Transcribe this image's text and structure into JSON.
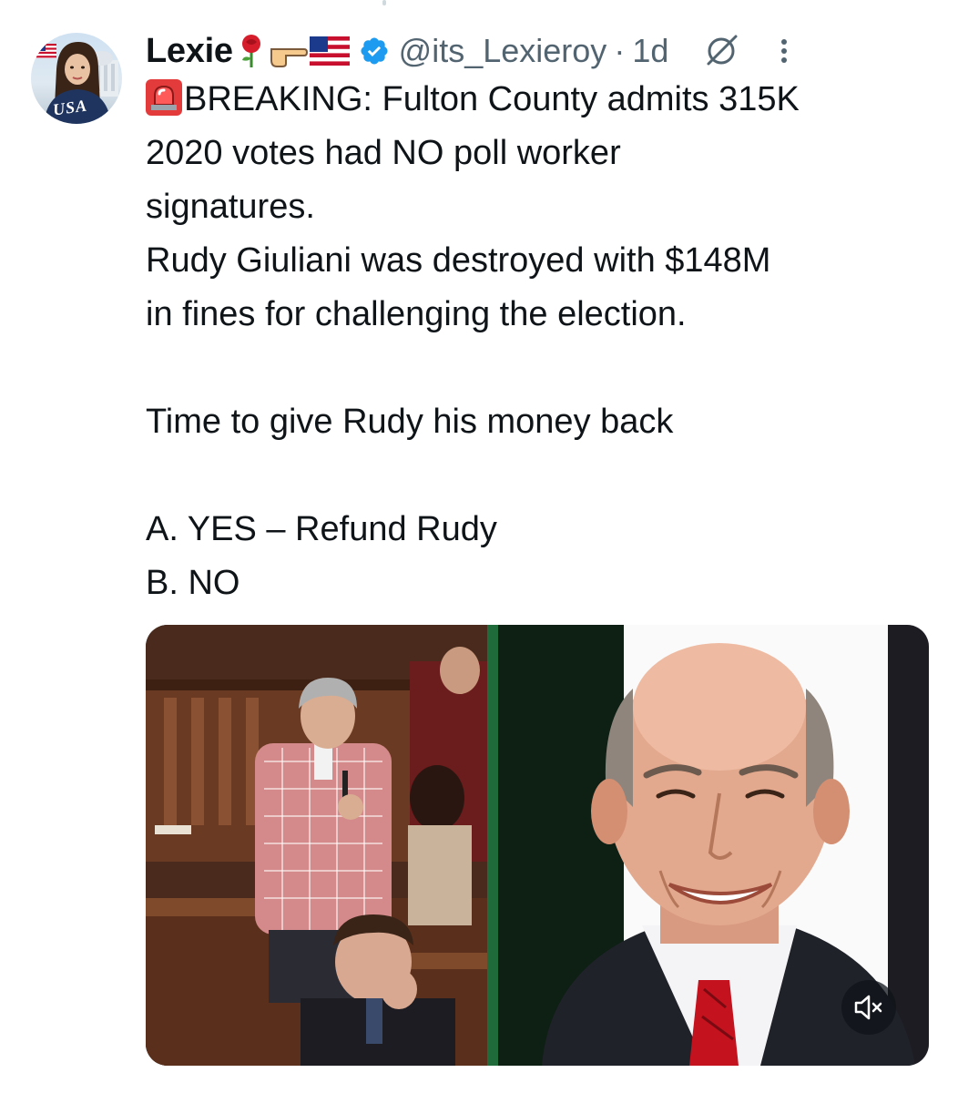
{
  "author": {
    "display_name": "Lexie",
    "handle": "@its_Lexieroy",
    "separator": "·",
    "time": "1d",
    "avatar_text": "USA"
  },
  "header_icons": {
    "name_emojis": [
      "rose-emoji",
      "pointing-hand-emoji",
      "us-flag-emoji"
    ],
    "verified": "verified-badge-icon",
    "grok": "grok-icon",
    "more": "more-icon"
  },
  "tweet": {
    "lines": [
      "BREAKING: Fulton County admits 315K",
      "2020 votes had NO poll worker",
      "signatures.",
      "Rudy Giuliani was destroyed with $148M",
      "in fines for challenging the election.",
      "Time to give Rudy his money back",
      "A. YES – Refund Rudy",
      "B. NO"
    ]
  },
  "media": {
    "mute_icon": "volume-muted-icon"
  },
  "colors": {
    "text": "#0f1419",
    "secondary": "#536471",
    "verified_blue": "#1d9bf0"
  }
}
